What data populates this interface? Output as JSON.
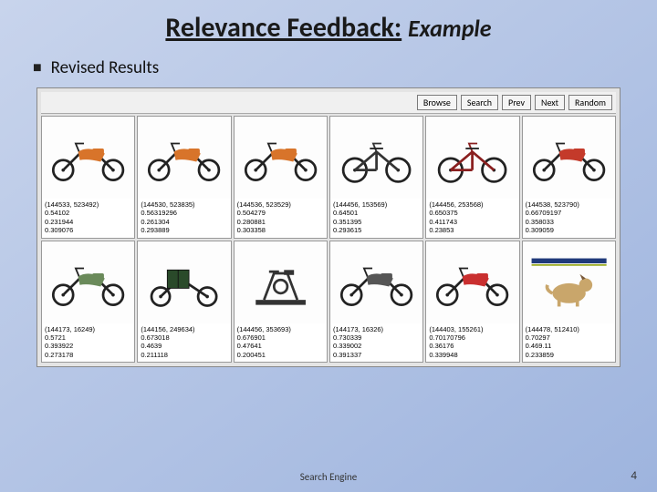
{
  "title_main": "Relevance Feedback:",
  "title_sub": "Example",
  "subtitle": "Revised Results",
  "toolbar": {
    "browse": "Browse",
    "search": "Search",
    "prev": "Prev",
    "next": "Next",
    "random": "Random"
  },
  "results": [
    {
      "id": "(144533, 523492)",
      "v1": "0.54102",
      "v2": "0.231944",
      "v3": "0.309076",
      "kind": "dirtbike",
      "color": "#d8742a"
    },
    {
      "id": "(144530, 523835)",
      "v1": "0.56319296",
      "v2": "0.261304",
      "v3": "0.293889",
      "kind": "dirtbike",
      "color": "#d8742a"
    },
    {
      "id": "(144536, 523529)",
      "v1": "0.504279",
      "v2": "0.280881",
      "v3": "0.303358",
      "kind": "dirtbike",
      "color": "#d8742a"
    },
    {
      "id": "(144456, 153569)",
      "v1": "0.64501",
      "v2": "0.351395",
      "v3": "0.293615",
      "kind": "bmx",
      "color": "#333333"
    },
    {
      "id": "(144456, 253568)",
      "v1": "0.650375",
      "v2": "0.411743",
      "v3": "0.23853",
      "kind": "bmx",
      "color": "#8a1f1f"
    },
    {
      "id": "(144538, 523790)",
      "v1": "0.66709197",
      "v2": "0.358033",
      "v3": "0.309059",
      "kind": "dirtbike",
      "color": "#c43a2a"
    },
    {
      "id": "(144173, 16249)",
      "v1": "0.5721",
      "v2": "0.393922",
      "v3": "0.273178",
      "kind": "moto",
      "color": "#6a8a5a"
    },
    {
      "id": "(144156, 249634)",
      "v1": "0.673018",
      "v2": "0.4639",
      "v3": "0.211118",
      "kind": "cargo",
      "color": "#2a4a2a"
    },
    {
      "id": "(144456, 353693)",
      "v1": "0.676901",
      "v2": "0.47641",
      "v3": "0.200451",
      "kind": "exercise",
      "color": "#333"
    },
    {
      "id": "(144173, 16326)",
      "v1": "0.730339",
      "v2": "0.339002",
      "v3": "0.391337",
      "kind": "moto",
      "color": "#555"
    },
    {
      "id": "(144403, 155261)",
      "v1": "0.70170796",
      "v2": "0.36176",
      "v3": "0.339948",
      "kind": "dirtbike",
      "color": "#c92f2f"
    },
    {
      "id": "(144478, 512410)",
      "v1": "0.70297",
      "v2": "0.469.11",
      "v3": "0.233859",
      "kind": "dog",
      "color": "#c9a66b"
    }
  ],
  "footer_center": "Search Engine",
  "footer_right": "4"
}
